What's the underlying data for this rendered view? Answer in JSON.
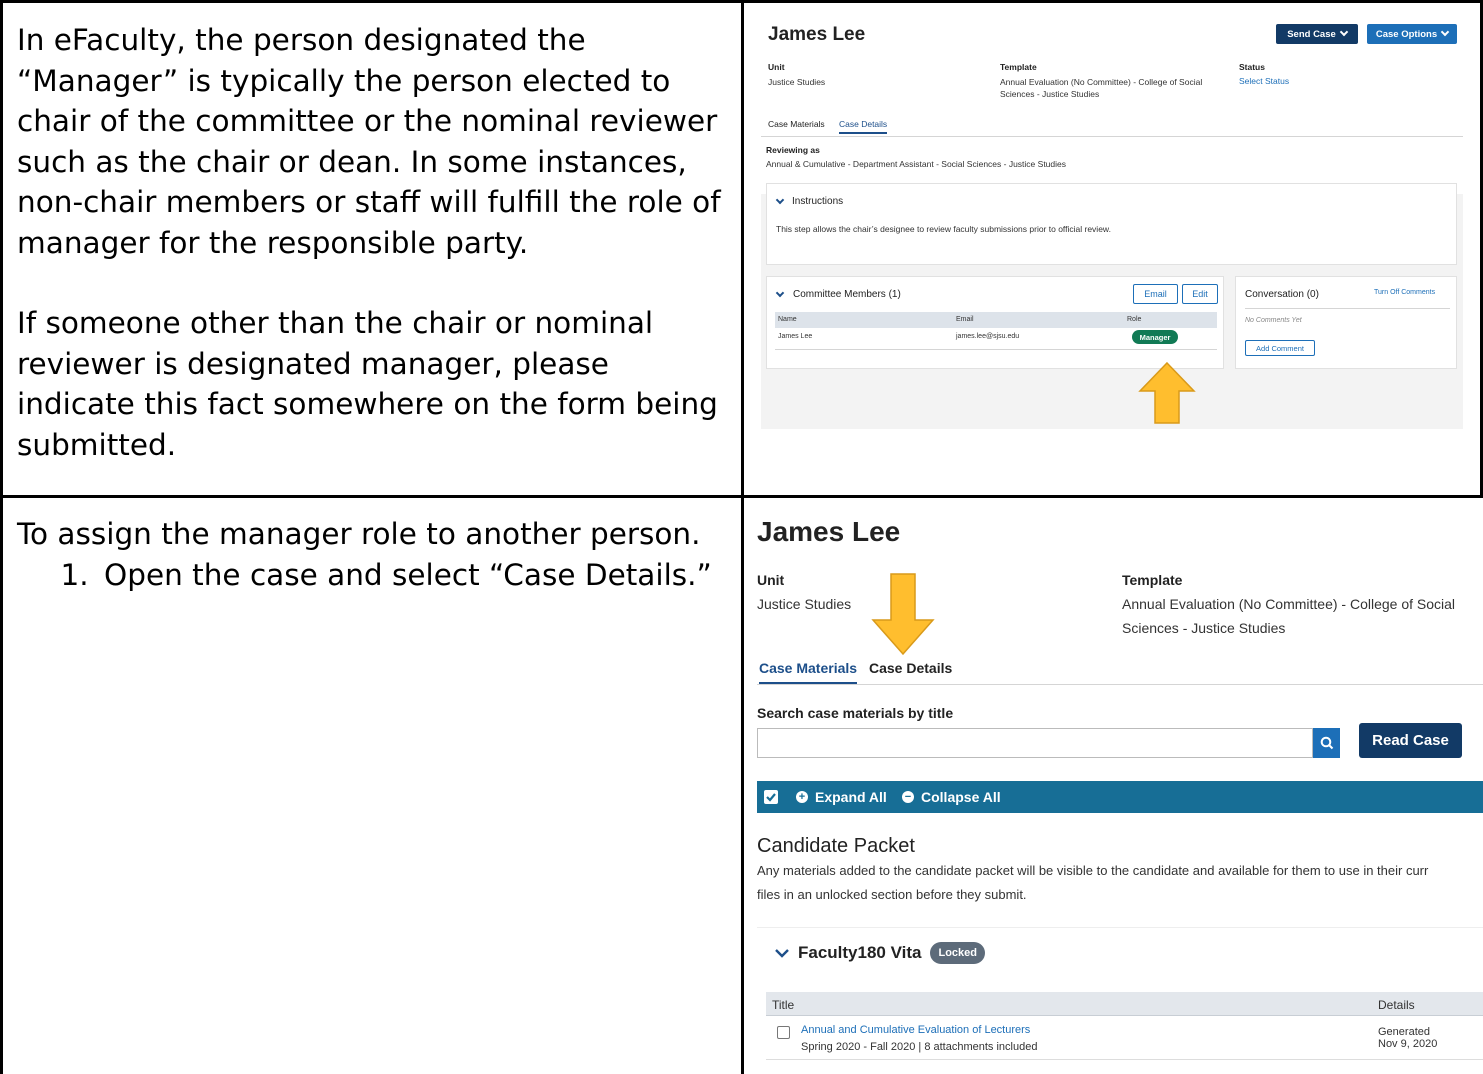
{
  "rows": [
    {
      "text_paragraphs": [
        "In eFaculty, the person designated the “Manager” is typically the person elected to chair of the committee or the nominal reviewer such as the chair or dean. In some instances, non-chair members or staff will fulfill the role of manager for the responsible party.",
        "If someone other than the chair or nominal reviewer is designated manager, please indicate this fact somewhere on the form being submitted."
      ],
      "screenshot": {
        "name": "James Lee",
        "send_case": "Send Case",
        "case_options": "Case Options",
        "unit_label": "Unit",
        "unit_value": "Justice Studies",
        "template_label": "Template",
        "template_value_1": "Annual Evaluation (No Committee) - College of Social",
        "template_value_2": "Sciences - Justice Studies",
        "status_label": "Status",
        "status_value": "Select Status",
        "tab_materials": "Case Materials",
        "tab_details": "Case Details",
        "reviewing_label": "Reviewing as",
        "reviewing_value": "Annual & Cumulative - Department Assistant - Social Sciences - Justice Studies",
        "instructions_title": "Instructions",
        "instructions_text": "This step allows the chair’s designee to review faculty submissions prior to official review.",
        "committee_title": "Committee Members (1)",
        "email_btn": "Email",
        "edit_btn": "Edit",
        "col_name": "Name",
        "col_email": "Email",
        "col_role": "Role",
        "member_name": "James Lee",
        "member_email": "james.lee@sjsu.edu",
        "member_role": "Manager",
        "conversation_title": "Conversation (0)",
        "turn_off_comments": "Turn Off Comments",
        "no_comments": "No Comments Yet",
        "add_comment": "Add Comment"
      }
    },
    {
      "intro": "To assign the manager role to another person.",
      "steps": [
        "Open the case and select “Case Details.”"
      ],
      "screenshot": {
        "name": "James Lee",
        "unit_label": "Unit",
        "unit_value": "Justice Studies",
        "template_label": "Template",
        "template_value_1": "Annual Evaluation (No Committee) - College of Social",
        "template_value_2": "Sciences - Justice Studies",
        "tab_materials": "Case Materials",
        "tab_details": "Case Details",
        "search_label": "Search case materials by title",
        "search_value": "",
        "read_case": "Read Case",
        "expand_all": "Expand All",
        "collapse_all": "Collapse All",
        "packet_title": "Candidate Packet",
        "packet_desc_1": "Any materials added to the candidate packet will be visible to the candidate and available for them to use in their curr",
        "packet_desc_2": "files in an unlocked section before they submit.",
        "section_title": "Faculty180 Vita",
        "section_badge": "Locked",
        "col_title": "Title",
        "col_details": "Details",
        "item_title": "Annual and Cumulative Evaluation of Lecturers",
        "item_sub": "Spring 2020 - Fall 2020 | 8 attachments included",
        "item_details_1": "Generated",
        "item_details_2": "Nov 9, 2020"
      }
    }
  ],
  "colors": {
    "arrow": "#ffbe2e",
    "navy": "#123a66",
    "blue": "#1d6fb8",
    "green": "#117a55",
    "bar": "#176e96"
  }
}
